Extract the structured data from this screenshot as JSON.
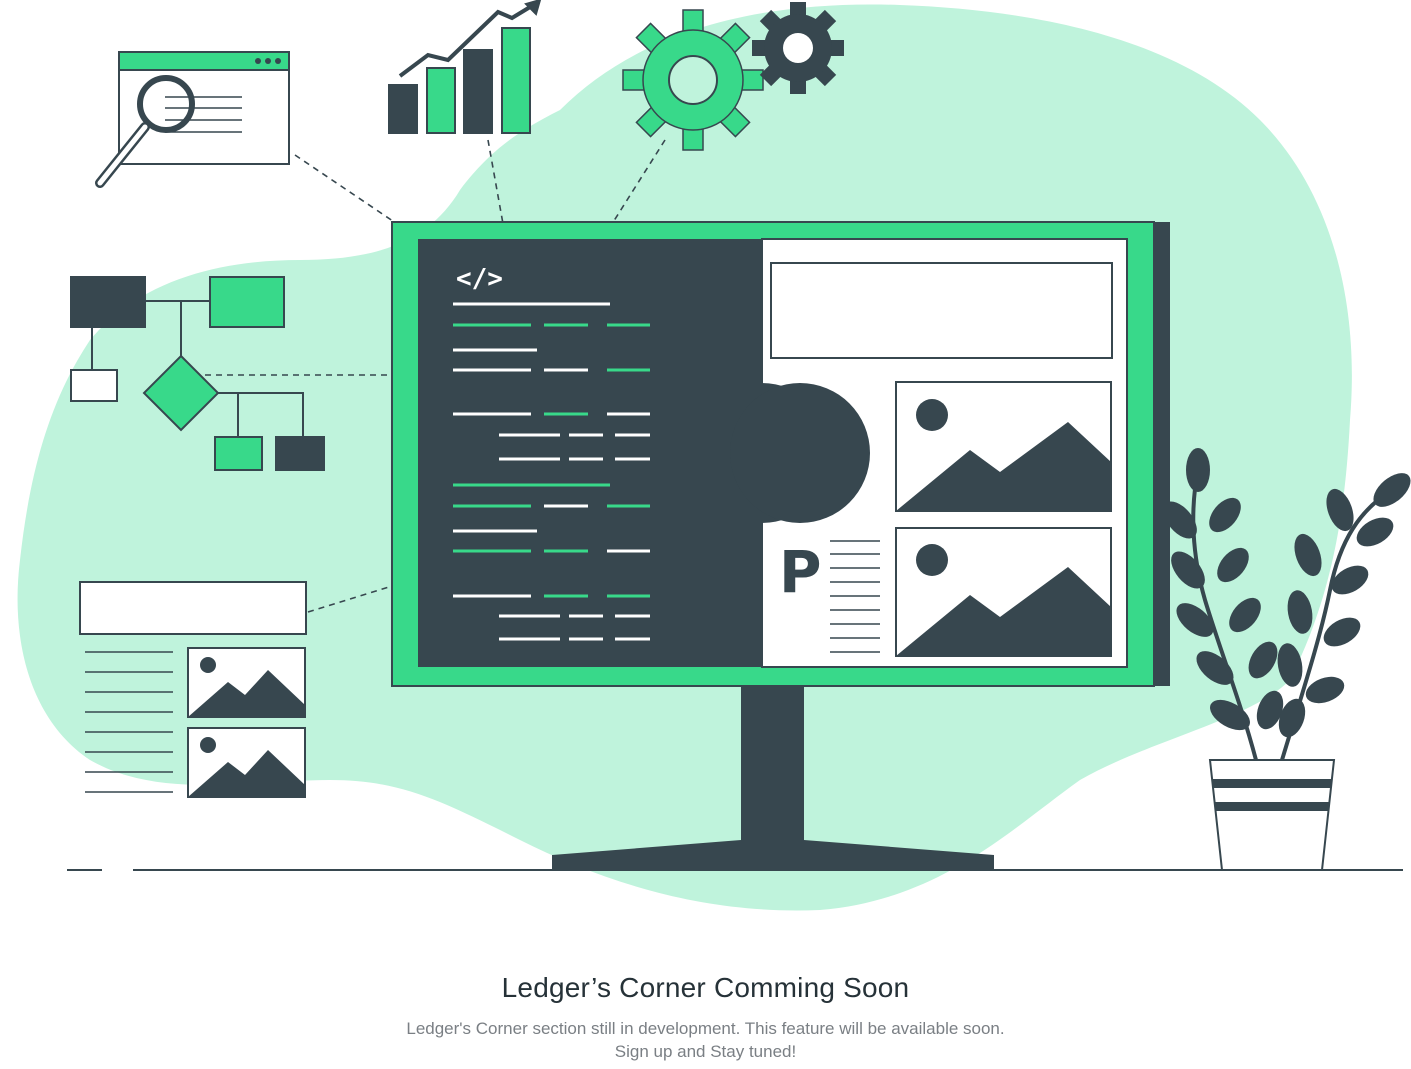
{
  "empty_state": {
    "title": "Ledger’s Corner Comming Soon",
    "description_line1": "Ledger's Corner section still in development. This feature will be available soon.",
    "description_line2": "Sign up and Stay tuned!"
  },
  "illustration": {
    "code_tag": "</>",
    "logo_letter": "P",
    "icons": [
      "magnifier-window-icon",
      "growth-bar-chart-icon",
      "gears-icon",
      "flowchart-icon",
      "document-layout-icon",
      "monitor-icon",
      "potted-plant-icon"
    ]
  },
  "colors": {
    "accent": "#38d98a",
    "blob": "#bff3dc",
    "dark": "#37474f",
    "text_title": "#263238",
    "text_body": "#7a7f84"
  }
}
